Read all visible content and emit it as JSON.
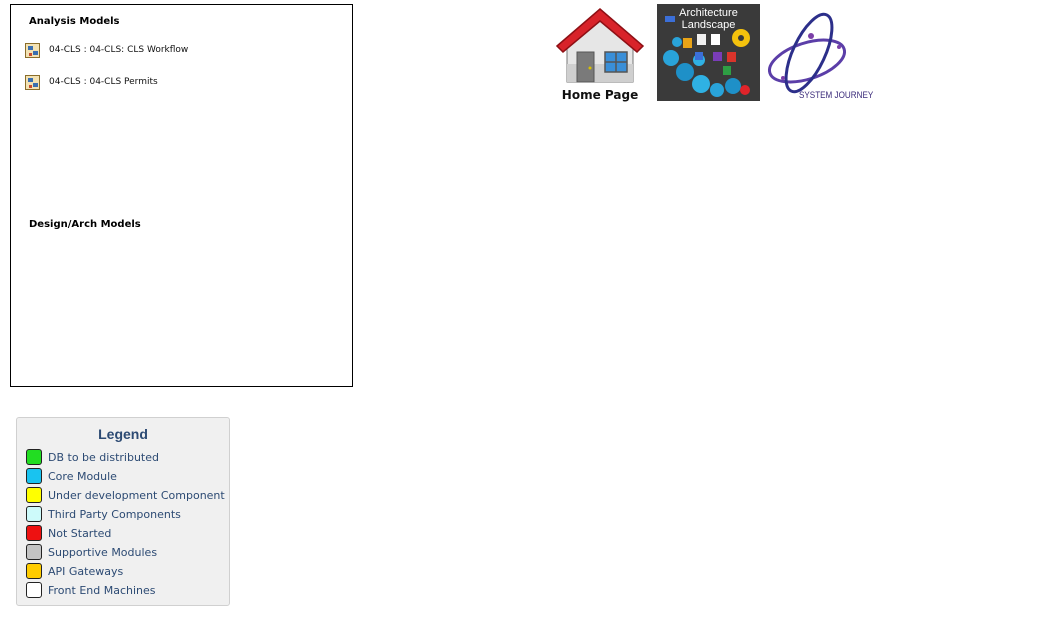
{
  "models_panel": {
    "analysis_heading": "Analysis Models",
    "analysis_items": [
      {
        "label": "04-CLS : 04-CLS: CLS Workflow",
        "icon": "analysis-diagram-icon"
      },
      {
        "label": "04-CLS : 04-CLS Permits",
        "icon": "analysis-diagram-icon"
      }
    ],
    "design_heading": "Design/Arch Models"
  },
  "nav_links": {
    "home_label": "Home Page",
    "arch_label_line1": "Architecture",
    "arch_label_line2": "Landscape",
    "journey_label": "SYSTEM JOURNEY"
  },
  "legend": {
    "title": "Legend",
    "items": [
      {
        "label": "DB to be distributed",
        "color": "#22dd22"
      },
      {
        "label": "Core Module",
        "color": "#19c3f0"
      },
      {
        "label": "Under development Component",
        "color": "#ffff00"
      },
      {
        "label": "Third Party Components",
        "color": "#cdfafa"
      },
      {
        "label": "Not Started",
        "color": "#ee1111"
      },
      {
        "label": "Supportive Modules",
        "color": "#c4c4c4"
      },
      {
        "label": "API Gateways",
        "color": "#ffcc00"
      },
      {
        "label": "Front End Machines",
        "color": "#ffffff"
      }
    ]
  }
}
